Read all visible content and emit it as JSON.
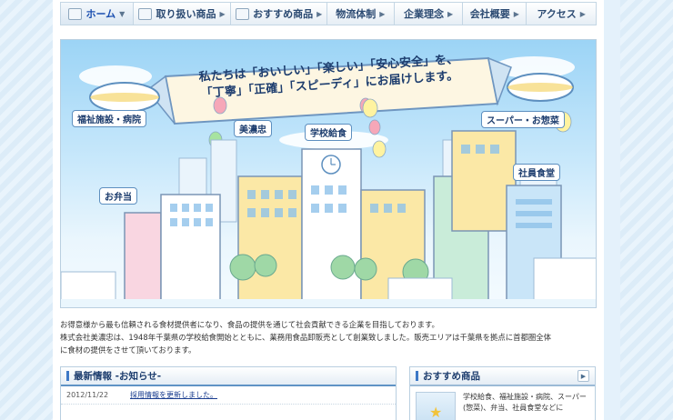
{
  "nav": [
    {
      "label": "ホーム",
      "icon": "house-icon",
      "arrow": "▼",
      "active": true
    },
    {
      "label": "取り扱い商品",
      "icon": "book-icon",
      "arrow": "▶"
    },
    {
      "label": "おすすめ商品",
      "icon": "star-icon",
      "arrow": "▶"
    },
    {
      "label": "物流体制",
      "arrow": "▶"
    },
    {
      "label": "企業理念",
      "arrow": "▶"
    },
    {
      "label": "会社概要",
      "arrow": "▶"
    },
    {
      "label": "アクセス",
      "arrow": "▶"
    }
  ],
  "hero": {
    "banner_line1": "私たちは「おいしい」「楽しい」「安心安全」を、",
    "banner_line2": "「丁寧」「正確」「スピーディ」にお届けします。",
    "labels": {
      "welfare": "福祉施設・病院",
      "minoh": "美濃忠",
      "school": "学校給食",
      "super": "スーパー・お惣菜",
      "bento": "お弁当",
      "cafeteria": "社員食堂"
    }
  },
  "intro": {
    "line1": "お得意様から最も信頼される食材提供者になり、食品の提供を通じて社会貢献できる企業を目指しております。",
    "line2": "株式会社美濃忠は、1948年千葉県の学校給食開始とともに、業務用食品卸販売として創業致しました。販売エリアは千葉県を拠点に首都圏全体",
    "line3": "に食材の提供をさせて頂いております。"
  },
  "news": {
    "title": "最新情報 -お知らせ-",
    "items": [
      {
        "date": "2012/11/22",
        "text": "採用情報を更新しました。"
      }
    ]
  },
  "recommended": {
    "title": "おすすめ商品",
    "arrow": "▶",
    "text": "学校給食、福祉施設・病院、スーパー(惣菜)、弁当、社員食堂などに"
  }
}
